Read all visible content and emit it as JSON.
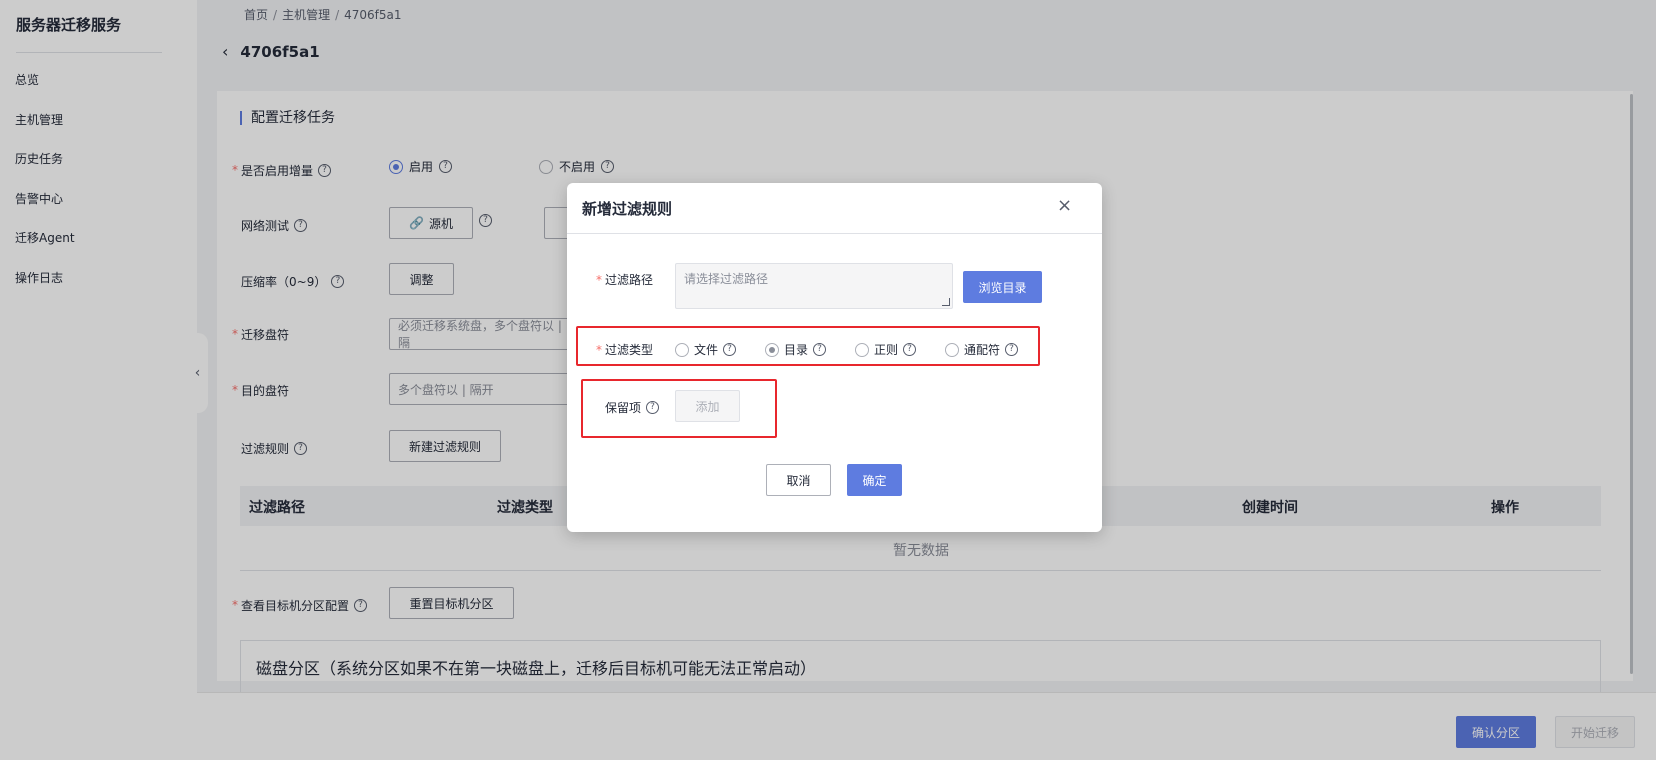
{
  "sidebar": {
    "title": "服务器迁移服务",
    "items": [
      {
        "label": "总览"
      },
      {
        "label": "主机管理"
      },
      {
        "label": "历史任务"
      },
      {
        "label": "告警中心"
      },
      {
        "label": "迁移Agent"
      },
      {
        "label": "操作日志"
      }
    ],
    "collapse_icon": "chevron-left-icon"
  },
  "breadcrumb": {
    "items": [
      "首页",
      "主机管理",
      "4706f5a1"
    ],
    "separator": "/"
  },
  "page": {
    "title": "4706f5a1",
    "back_icon": "chevron-left-icon"
  },
  "form": {
    "section_title": "配置迁移任务",
    "incremental": {
      "label": "是否启用增量",
      "options": [
        {
          "label": "启用",
          "selected": true
        },
        {
          "label": "不启用",
          "selected": false
        }
      ]
    },
    "network_test": {
      "label": "网络测试",
      "source_button": "源机"
    },
    "compression": {
      "label": "压缩率（0~9）",
      "adjust_button": "调整"
    },
    "migrate_drive": {
      "label": "迁移盘符",
      "placeholder": "必须迁移系统盘，多个盘符以 | 隔"
    },
    "target_drive": {
      "label": "目的盘符",
      "placeholder": "多个盘符以 | 隔开"
    },
    "filter_rules": {
      "label": "过滤规则",
      "new_button": "新建过滤规则"
    },
    "table": {
      "columns": [
        "过滤路径",
        "过滤类型",
        "创建时间",
        "操作"
      ],
      "empty_text": "暂无数据"
    },
    "partition_config": {
      "label": "查看目标机分区配置",
      "reset_button": "重置目标机分区"
    },
    "partition_title": "磁盘分区（系统分区如果不在第一块磁盘上，迁移后目标机可能无法正常启动）"
  },
  "footer": {
    "confirm_button": "确认分区",
    "start_button": "开始迁移"
  },
  "modal": {
    "title": "新增过滤规则",
    "close_icon": "close-icon",
    "path": {
      "label": "过滤路径",
      "placeholder": "请选择过滤路径",
      "browse_button": "浏览目录"
    },
    "type": {
      "label": "过滤类型",
      "options": [
        {
          "label": "文件",
          "selected": false
        },
        {
          "label": "目录",
          "selected": true
        },
        {
          "label": "正则",
          "selected": false
        },
        {
          "label": "通配符",
          "selected": false
        }
      ]
    },
    "retain": {
      "label": "保留项",
      "add_button": "添加"
    },
    "cancel_button": "取消",
    "ok_button": "确定"
  },
  "colors": {
    "primary": "#5e7ce0",
    "required": "#f66f6a",
    "highlight": "#e8272d"
  }
}
